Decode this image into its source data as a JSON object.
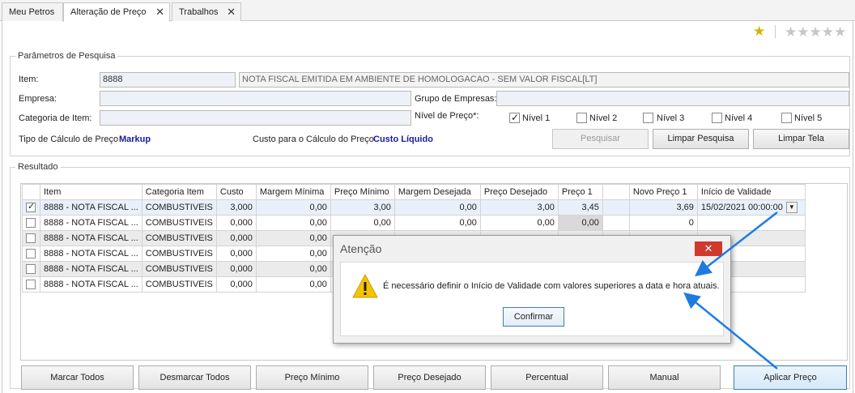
{
  "tabs": [
    {
      "label": "Meu Petros"
    },
    {
      "label": "Alteração de Preço"
    },
    {
      "label": "Trabalhos"
    }
  ],
  "params": {
    "legend": "Parâmetros de Pesquisa",
    "item_label": "Item:",
    "item_code": "8888",
    "item_desc": "NOTA FISCAL EMITIDA EM AMBIENTE DE HOMOLOGACAO - SEM VALOR FISCAL[LT]",
    "empresa_label": "Empresa:",
    "grupo_label": "Grupo de Empresas:",
    "categoria_label": "Categoria de Item:",
    "nivel_label": "Nível de Preço*:",
    "niveis": [
      "Nível 1",
      "Nível 2",
      "Nível 3",
      "Nível 4",
      "Nível 5"
    ],
    "tipo_calc_label": "Tipo de Cálculo de Preço",
    "tipo_calc_value": "Markup",
    "custo_calc_label": "Custo para o Cálculo do Preço",
    "custo_calc_value": "Custo Líquido",
    "btn_pesquisar": "Pesquisar",
    "btn_limpar_pesquisa": "Limpar Pesquisa",
    "btn_limpar_tela": "Limpar Tela"
  },
  "result": {
    "legend": "Resultado",
    "columns": [
      "Item",
      "Categoria Item",
      "Custo",
      "Margem Mínima",
      "Preço Mínimo",
      "Margem Desejada",
      "Preço Desejado",
      "Preço 1",
      "",
      "Novo Preço 1",
      "Início de Validade"
    ],
    "rows": [
      {
        "item": "8888 - NOTA FISCAL ...",
        "cat": "COMBUSTIVEIS",
        "custo": "3,000",
        "mmin": "0,00",
        "pmin": "3,00",
        "mdes": "0,00",
        "pdes": "3,00",
        "p1": "3,45",
        "novo": "3,69",
        "inicio": "15/02/2021 00:00:00"
      },
      {
        "item": "8888 - NOTA FISCAL ...",
        "cat": "COMBUSTIVEIS",
        "custo": "0,000",
        "mmin": "0,00",
        "pmin": "0,00",
        "mdes": "0,00",
        "pdes": "0,00",
        "p1": "0,00",
        "novo": "0",
        "inicio": ""
      },
      {
        "item": "8888 - NOTA FISCAL ...",
        "cat": "COMBUSTIVEIS",
        "custo": "0,000",
        "mmin": "0,00",
        "pmin": "",
        "mdes": "",
        "pdes": "",
        "p1": "",
        "novo": "",
        "inicio": ""
      },
      {
        "item": "8888 - NOTA FISCAL ...",
        "cat": "COMBUSTIVEIS",
        "custo": "0,000",
        "mmin": "0,00",
        "pmin": "",
        "mdes": "",
        "pdes": "",
        "p1": "",
        "novo": "",
        "inicio": ""
      },
      {
        "item": "8888 - NOTA FISCAL ...",
        "cat": "COMBUSTIVEIS",
        "custo": "0,000",
        "mmin": "0,00",
        "pmin": "",
        "mdes": "",
        "pdes": "",
        "p1": "",
        "novo": "",
        "inicio": ""
      },
      {
        "item": "8888 - NOTA FISCAL ...",
        "cat": "COMBUSTIVEIS",
        "custo": "0,000",
        "mmin": "0,00",
        "pmin": "",
        "mdes": "",
        "pdes": "",
        "p1": "",
        "novo": "",
        "inicio": ""
      }
    ]
  },
  "buttons": {
    "marcar_todos": "Marcar Todos",
    "desmarcar_todos": "Desmarcar Todos",
    "preco_minimo": "Preço Mínimo",
    "preco_desejado": "Preço Desejado",
    "percentual": "Percentual",
    "manual": "Manual",
    "aplicar": "Aplicar Preço"
  },
  "dialog": {
    "title": "Atenção",
    "close": "✕",
    "message": "É necessário definir o Início de Validade com valores superiores a data e hora atuais.",
    "confirm": "Confirmar"
  },
  "colors": {
    "accent": "#1a1aa6",
    "arrow": "#1e7be0",
    "close_red": "#d0392b"
  }
}
